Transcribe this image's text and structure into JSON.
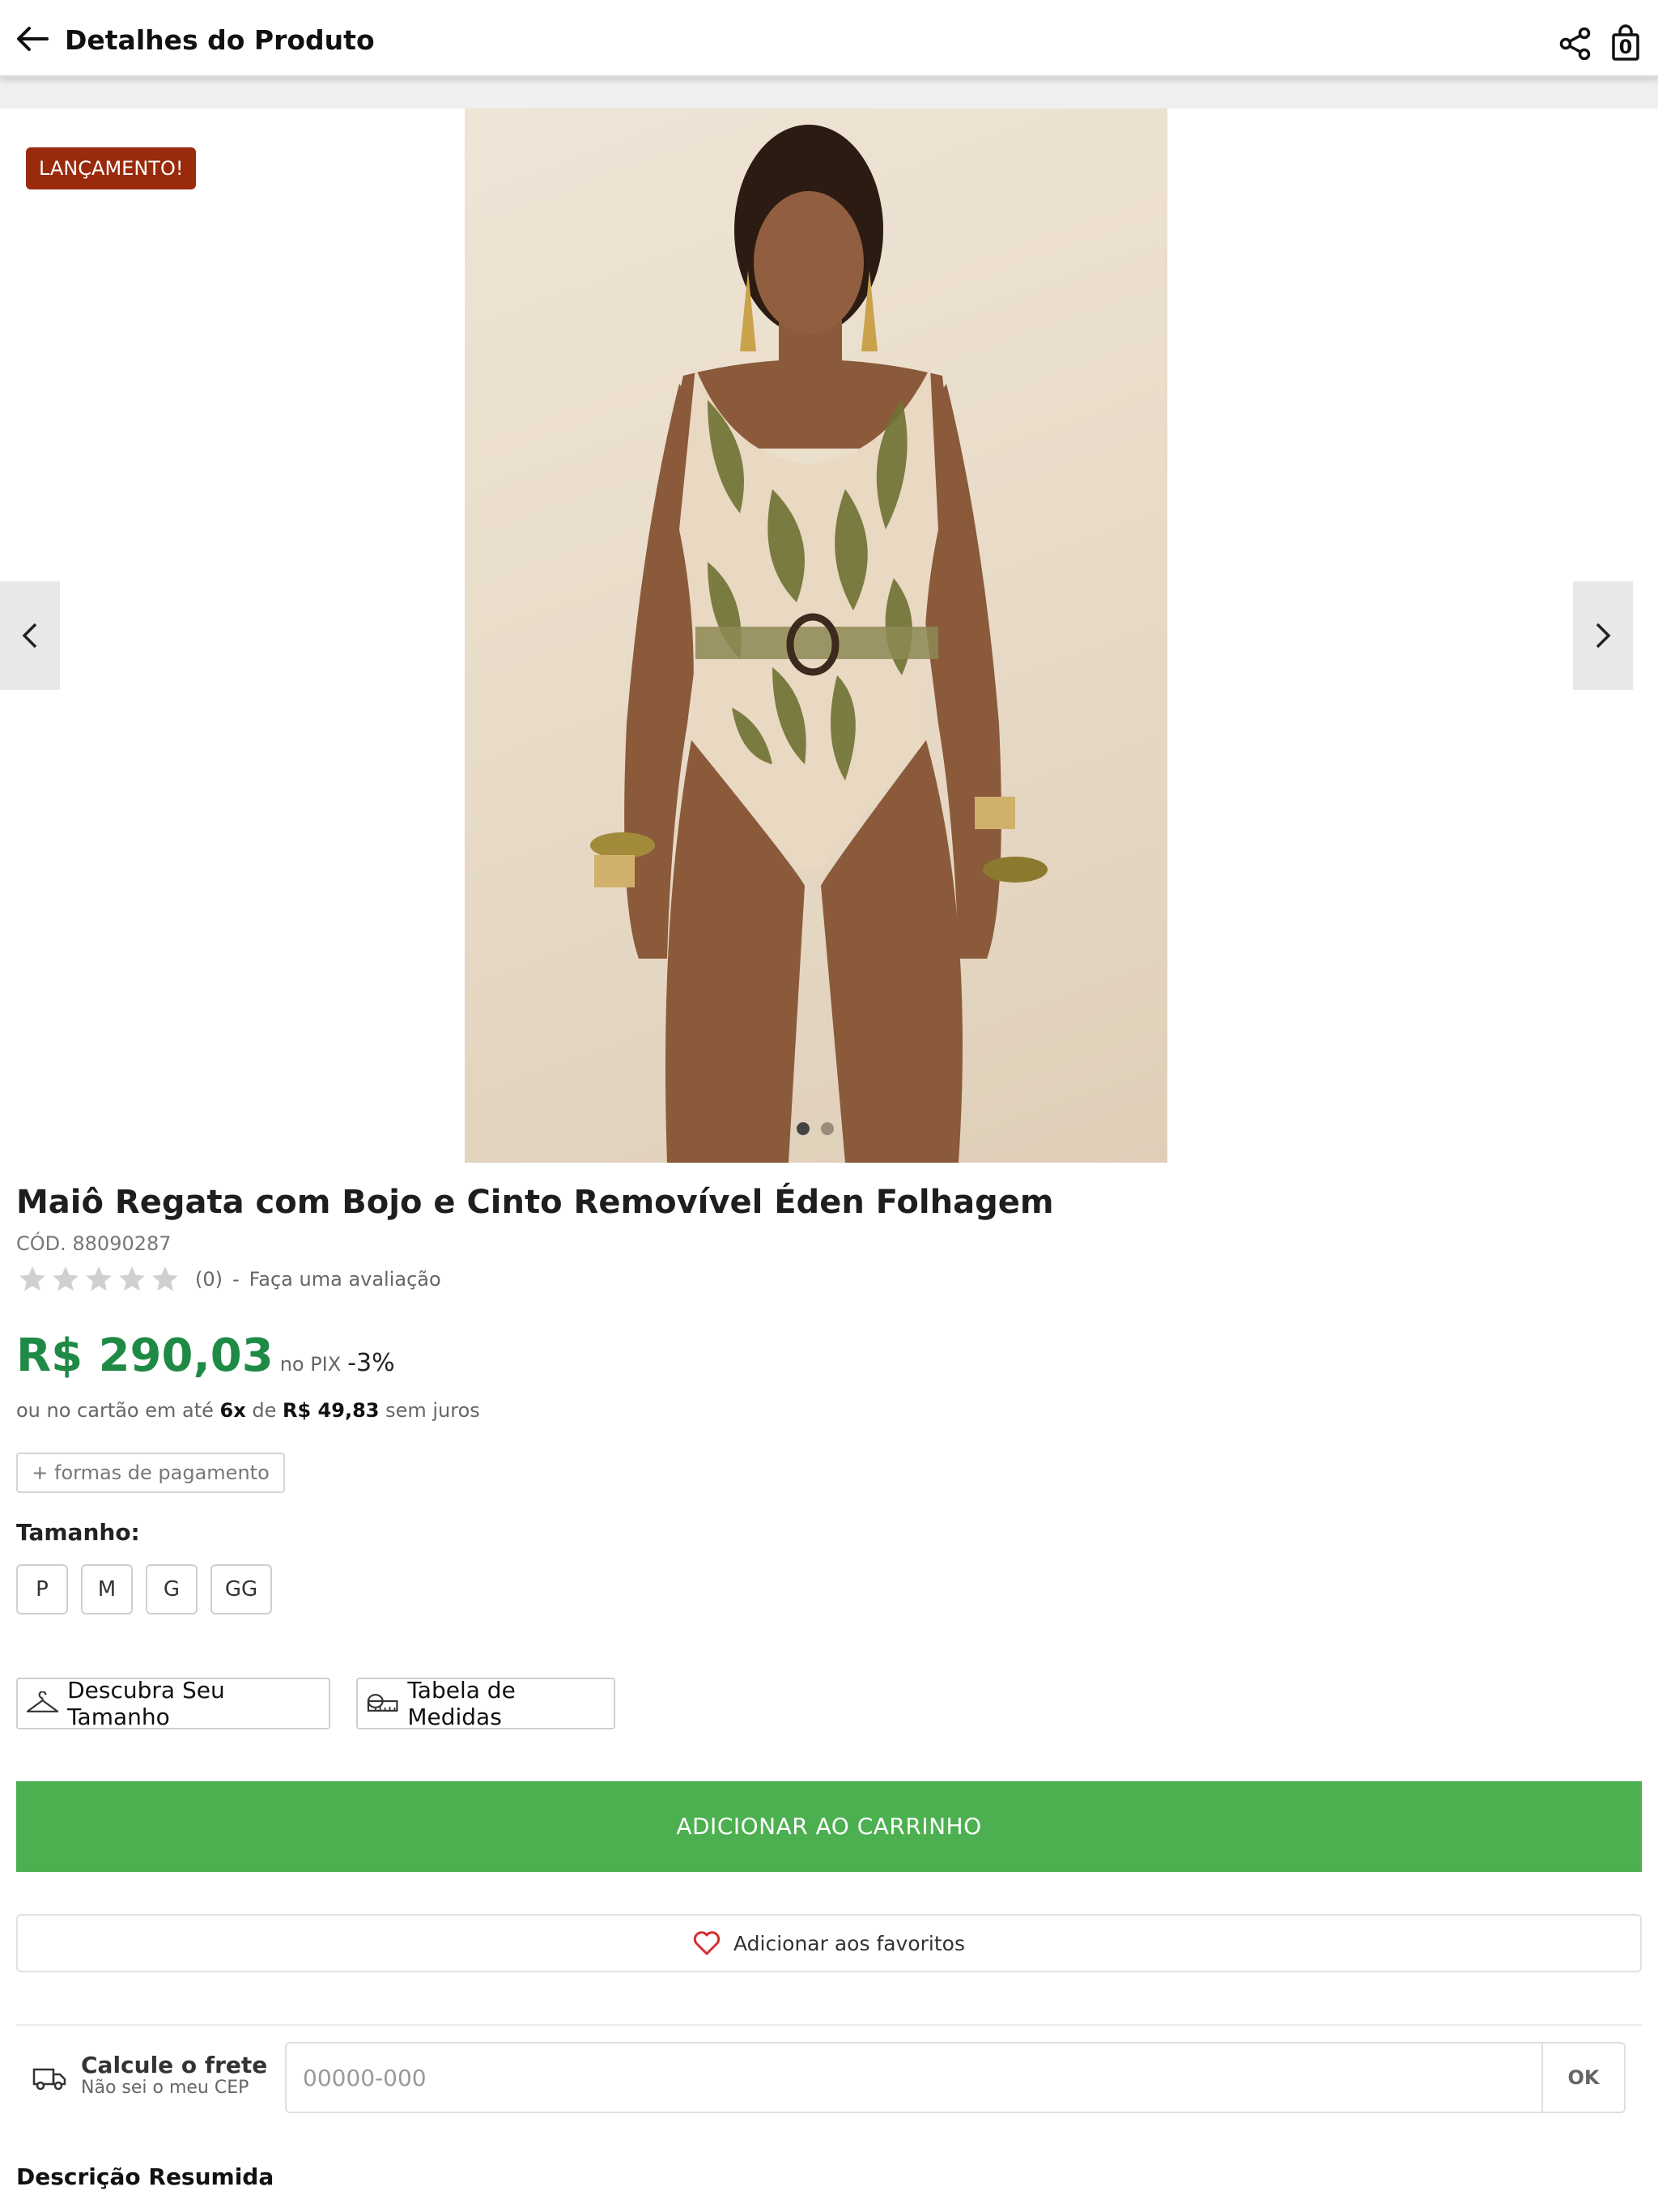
{
  "header": {
    "title": "Detalhes do Produto",
    "bag_count": "0",
    "icons": [
      "back-arrow-icon",
      "share-icon",
      "shopping-bag-icon"
    ]
  },
  "gallery": {
    "badge": "LANÇAMENTO!",
    "slide_count": 2,
    "active_slide": 1,
    "image_alt": "Maiô Regata com Bojo e Cinto Removível Éden Folhagem"
  },
  "product": {
    "name": "Maiô Regata com Bojo e Cinto Removível Éden Folhagem",
    "code": "CÓD. 88090287",
    "rating": {
      "stars": 0,
      "max_stars": 5,
      "count": "(0)",
      "separator": "-",
      "cta": "Faça uma avaliação"
    },
    "price": {
      "value": "R$ 290,03",
      "method": "no PIX",
      "discount": "-3%"
    },
    "installments": {
      "prefix": "ou no cartão em até",
      "count": "6x",
      "of": "de",
      "amount": "R$ 49,83",
      "suffix": "sem juros"
    },
    "payment_options_label": "+ formas de pagamento",
    "size_label": "Tamanho:",
    "sizes": [
      "P",
      "M",
      "G",
      "GG"
    ],
    "find_size_label": "Descubra Seu Tamanho",
    "measures_label": "Tabela de Medidas",
    "add_to_cart_label": "ADICIONAR AO CARRINHO",
    "favorite_label": "Adicionar aos favoritos"
  },
  "shipping": {
    "title": "Calcule o frete",
    "subtitle": "Não sei o meu CEP",
    "placeholder": "00000-000",
    "value": "",
    "ok_label": "OK"
  },
  "description": {
    "title": "Descrição Resumida"
  },
  "colors": {
    "price_green": "#1f8a45",
    "cart_green": "#4caf50",
    "badge_red": "#9a2a0c",
    "heart_red": "#d32f2f",
    "star_gray": "#d0d0d0"
  }
}
